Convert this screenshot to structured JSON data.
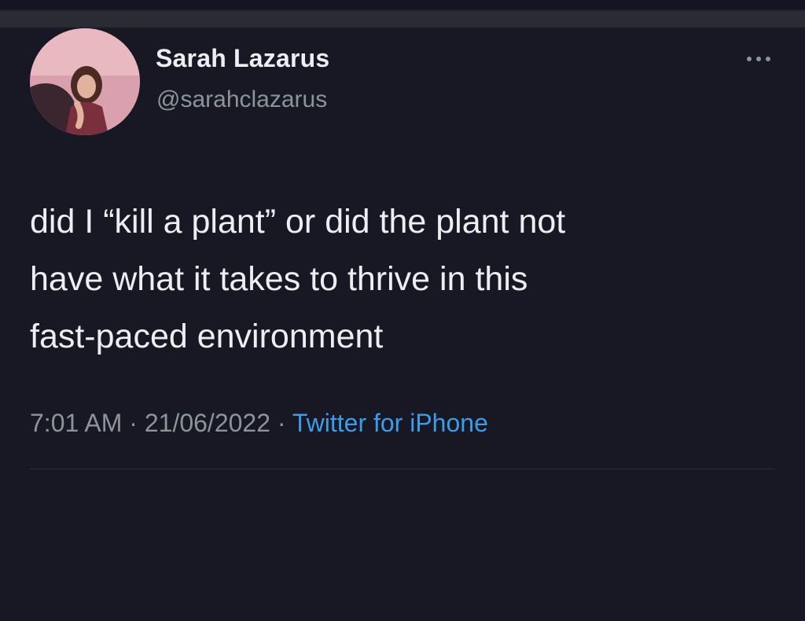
{
  "tweet": {
    "author": {
      "display_name": "Sarah Lazarus",
      "handle": "@sarahclazarus",
      "avatar": "profile-photo"
    },
    "text": "did I “kill a plant” or did the plant not\nhave what it takes to thrive in this\nfast-paced environment",
    "time": "7:01 AM",
    "separator": "·",
    "date": "21/06/2022",
    "source": "Twitter for iPhone"
  },
  "icons": {
    "more": "more-horizontal-icon"
  },
  "colors": {
    "background": "#171824",
    "text": "#eceef2",
    "muted": "#8e939b",
    "accent": "#3e9ce6"
  }
}
